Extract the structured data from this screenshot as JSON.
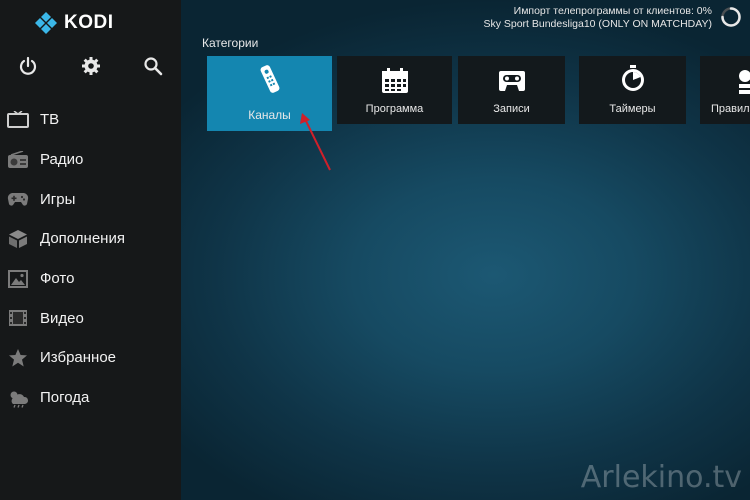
{
  "app": {
    "name": "KODI"
  },
  "top_icons": [
    {
      "name": "power-icon"
    },
    {
      "name": "gear-icon"
    },
    {
      "name": "search-icon"
    }
  ],
  "menu": [
    {
      "label": "ТВ",
      "icon": "tv-icon"
    },
    {
      "label": "Радио",
      "icon": "radio-icon"
    },
    {
      "label": "Игры",
      "icon": "gamepad-icon"
    },
    {
      "label": "Дополнения",
      "icon": "addons-box-icon"
    },
    {
      "label": "Фото",
      "icon": "photo-icon"
    },
    {
      "label": "Видео",
      "icon": "film-icon"
    },
    {
      "label": "Избранное",
      "icon": "star-icon"
    },
    {
      "label": "Погода",
      "icon": "weather-icon"
    }
  ],
  "status": {
    "line1": "Импорт телепрограммы от клиентов:  0%",
    "line2": "Sky Sport Bundesliga10 (ONLY ON MATCHDAY)"
  },
  "categories": {
    "title": "Категории",
    "tiles": [
      {
        "label": "Каналы",
        "icon": "remote-control-icon",
        "focused": true
      },
      {
        "label": "Программа",
        "icon": "calendar-icon"
      },
      {
        "label": "Записи",
        "icon": "cassette-icon"
      },
      {
        "label": "Таймеры",
        "icon": "stopwatch-icon"
      },
      {
        "label": "Правила",
        "icon": "rules-icon"
      }
    ]
  },
  "watermark": "Arlekino.tv",
  "colors": {
    "accent": "#1486b0",
    "sidebar": "#161819",
    "tile": "#13191c",
    "arrow": "#d0202a"
  }
}
